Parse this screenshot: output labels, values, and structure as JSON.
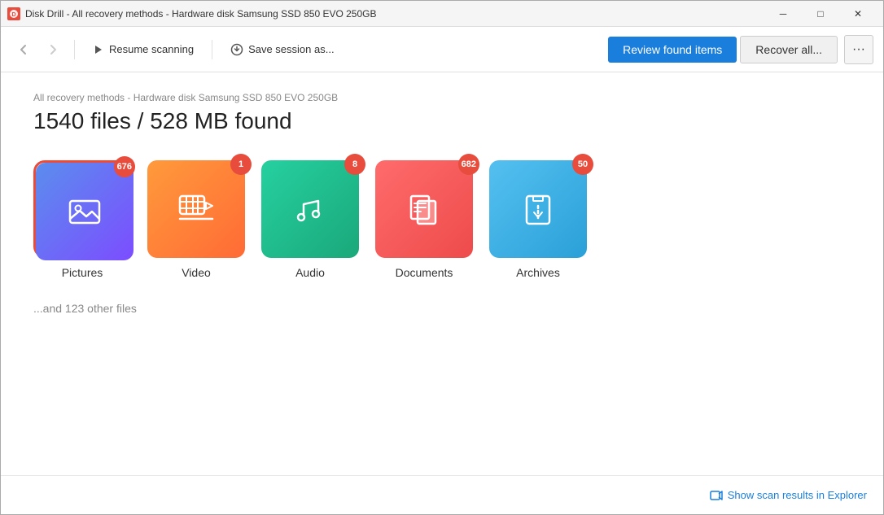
{
  "window": {
    "title": "Disk Drill - All recovery methods - Hardware disk Samsung SSD 850 EVO 250GB",
    "icon": "💿"
  },
  "titlebar_controls": {
    "minimize": "─",
    "maximize": "□",
    "close": "✕"
  },
  "toolbar": {
    "back_label": "←",
    "forward_label": "→",
    "resume_icon": "▶",
    "resume_label": "Resume scanning",
    "save_icon": "↓",
    "save_label": "Save session as...",
    "review_label": "Review found items",
    "recover_label": "Recover all...",
    "more_label": "···"
  },
  "content": {
    "breadcrumb": "All recovery methods - Hardware disk Samsung SSD 850 EVO 250GB",
    "title": "1540 files / 528 MB found",
    "categories": [
      {
        "key": "pictures",
        "label": "Pictures",
        "badge": "676",
        "selected": true
      },
      {
        "key": "video",
        "label": "Video",
        "badge": "1",
        "selected": false
      },
      {
        "key": "audio",
        "label": "Audio",
        "badge": "8",
        "selected": false
      },
      {
        "key": "documents",
        "label": "Documents",
        "badge": "682",
        "selected": false
      },
      {
        "key": "archives",
        "label": "Archives",
        "badge": "50",
        "selected": false
      }
    ],
    "other_files": "...and 123 other files"
  },
  "footer": {
    "show_results_label": "Show scan results in Explorer"
  }
}
